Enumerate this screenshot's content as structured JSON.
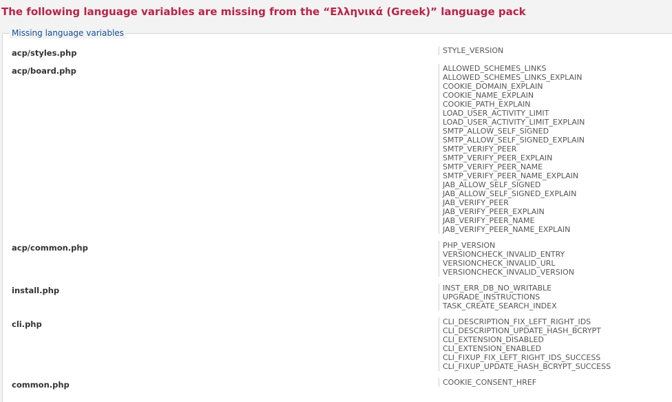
{
  "title": "The following language variables are missing from the “Ελληνικά (Greek)” language pack",
  "legend": "Missing language variables",
  "files": [
    {
      "name": "acp/styles.php",
      "vars": [
        "STYLE_VERSION"
      ]
    },
    {
      "name": "acp/board.php",
      "vars": [
        "ALLOWED_SCHEMES_LINKS",
        "ALLOWED_SCHEMES_LINKS_EXPLAIN",
        "COOKIE_DOMAIN_EXPLAIN",
        "COOKIE_NAME_EXPLAIN",
        "COOKIE_PATH_EXPLAIN",
        "LOAD_USER_ACTIVITY_LIMIT",
        "LOAD_USER_ACTIVITY_LIMIT_EXPLAIN",
        "SMTP_ALLOW_SELF_SIGNED",
        "SMTP_ALLOW_SELF_SIGNED_EXPLAIN",
        "SMTP_VERIFY_PEER",
        "SMTP_VERIFY_PEER_EXPLAIN",
        "SMTP_VERIFY_PEER_NAME",
        "SMTP_VERIFY_PEER_NAME_EXPLAIN",
        "JAB_ALLOW_SELF_SIGNED",
        "JAB_ALLOW_SELF_SIGNED_EXPLAIN",
        "JAB_VERIFY_PEER",
        "JAB_VERIFY_PEER_EXPLAIN",
        "JAB_VERIFY_PEER_NAME",
        "JAB_VERIFY_PEER_NAME_EXPLAIN"
      ]
    },
    {
      "name": "acp/common.php",
      "vars": [
        "PHP_VERSION",
        "VERSIONCHECK_INVALID_ENTRY",
        "VERSIONCHECK_INVALID_URL",
        "VERSIONCHECK_INVALID_VERSION"
      ]
    },
    {
      "name": "install.php",
      "vars": [
        "INST_ERR_DB_NO_WRITABLE",
        "UPGRADE_INSTRUCTIONS",
        "TASK_CREATE_SEARCH_INDEX"
      ]
    },
    {
      "name": "cli.php",
      "vars": [
        "CLI_DESCRIPTION_FIX_LEFT_RIGHT_IDS",
        "CLI_DESCRIPTION_UPDATE_HASH_BCRYPT",
        "CLI_EXTENSION_DISABLED",
        "CLI_EXTENSION_ENABLED",
        "CLI_FIXUP_FIX_LEFT_RIGHT_IDS_SUCCESS",
        "CLI_FIXUP_UPDATE_HASH_BCRYPT_SUCCESS"
      ]
    },
    {
      "name": "common.php",
      "vars": [
        "COOKIE_CONSENT_HREF"
      ]
    }
  ]
}
